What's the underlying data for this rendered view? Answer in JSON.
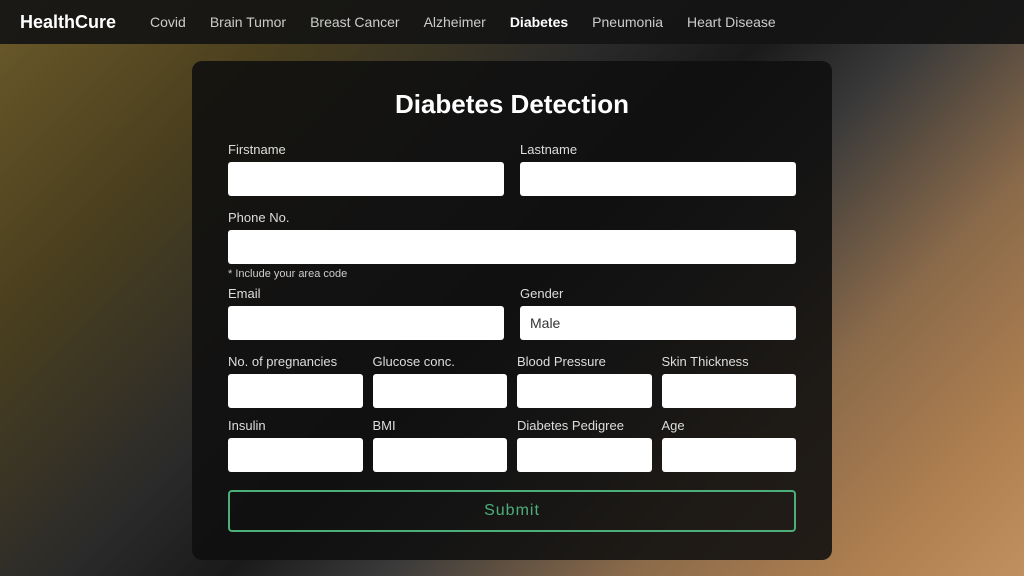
{
  "app": {
    "brand": "HealthCure"
  },
  "nav": {
    "items": [
      {
        "label": "Covid",
        "active": false
      },
      {
        "label": "Brain Tumor",
        "active": false
      },
      {
        "label": "Breast Cancer",
        "active": false
      },
      {
        "label": "Alzheimer",
        "active": false
      },
      {
        "label": "Diabetes",
        "active": true
      },
      {
        "label": "Pneumonia",
        "active": false
      },
      {
        "label": "Heart Disease",
        "active": false
      }
    ]
  },
  "form": {
    "title": "Diabetes Detection",
    "firstname_label": "Firstname",
    "lastname_label": "Lastname",
    "phone_label": "Phone No.",
    "phone_hint": "* Include your area code",
    "email_label": "Email",
    "gender_label": "Gender",
    "gender_value": "Male",
    "pregnancies_label": "No. of pregnancies",
    "glucose_label": "Glucose conc.",
    "bp_label": "Blood Pressure",
    "skin_label": "Skin Thickness",
    "insulin_label": "Insulin",
    "bmi_label": "BMI",
    "diabetes_pedigree_label": "Diabetes Pedigree",
    "age_label": "Age",
    "submit_label": "Submit"
  }
}
